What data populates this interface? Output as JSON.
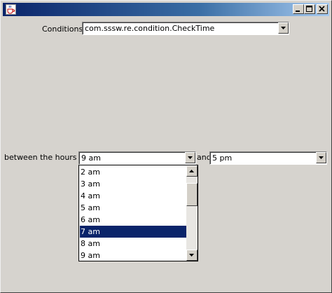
{
  "window": {
    "title": "",
    "controls": {
      "minimize": "minimize",
      "maximize": "maximize",
      "close": "close"
    }
  },
  "conditions": {
    "label": "Conditions",
    "selected": "com.sssw.re.condition.CheckTime"
  },
  "time_range": {
    "prefix_label": "between the hours of",
    "start_selected": "9 am",
    "connector_label": "and",
    "end_selected": "5 pm"
  },
  "dropdown_list": {
    "items": [
      "2 am",
      "3 am",
      "4 am",
      "5 am",
      "6 am",
      "7 am",
      "8 am",
      "9 am"
    ],
    "highlighted": "7 am"
  },
  "colors": {
    "selection": "#0a246a",
    "window_bg": "#d6d3ce",
    "title_gradient_start": "#0a246a",
    "title_gradient_end": "#a6caf0"
  },
  "icons": {
    "app": "java-cup-icon",
    "combo_arrow": "chevron-down-icon",
    "scroll_up": "arrow-up-icon",
    "scroll_down": "arrow-down-icon"
  }
}
